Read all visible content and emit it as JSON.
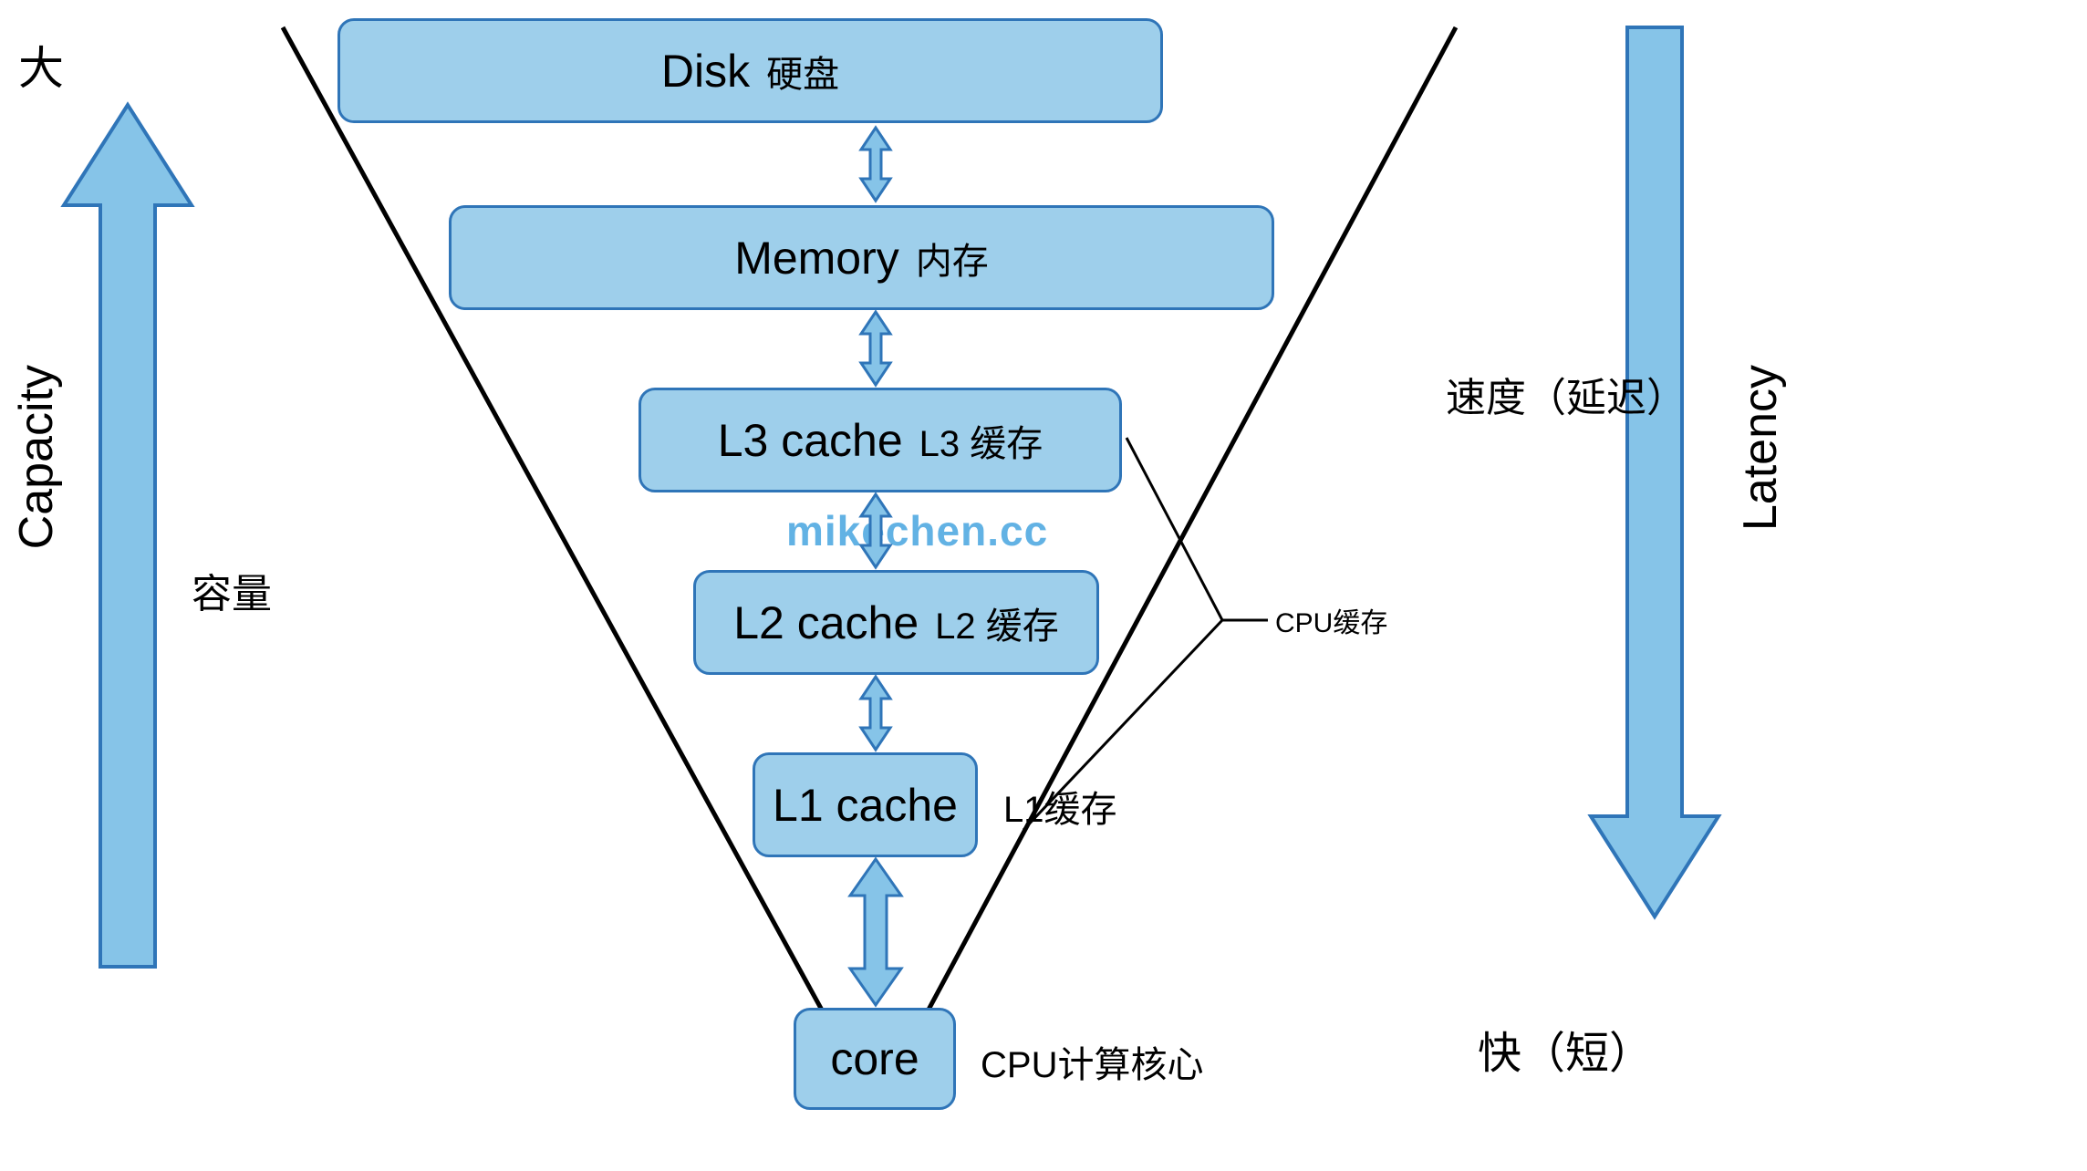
{
  "left_arrow": {
    "top_label": "大",
    "axis_en": "Capacity",
    "axis_cn": "容量"
  },
  "right_arrow": {
    "axis_en": "Latency",
    "axis_cn": "速度（延迟）",
    "bottom_label": "快（短）"
  },
  "levels": {
    "disk": {
      "en": "Disk",
      "cn": "硬盘"
    },
    "memory": {
      "en": "Memory",
      "cn": "内存"
    },
    "l3": {
      "en": "L3 cache",
      "cn": "L3 缓存"
    },
    "l2": {
      "en": "L2 cache",
      "cn": "L2 缓存"
    },
    "l1": {
      "en": "L1 cache",
      "cn": "L1缓存"
    },
    "core": {
      "en": "core",
      "cn": "CPU计算核心"
    }
  },
  "cpu_cache_note": "CPU缓存",
  "watermark": "mikechen.cc",
  "colors": {
    "box_fill": "#9ecfeb",
    "box_border": "#2f75b8",
    "arrow_fill": "#86c4e8",
    "arrow_border": "#2f75b8",
    "v_line": "#000000"
  }
}
